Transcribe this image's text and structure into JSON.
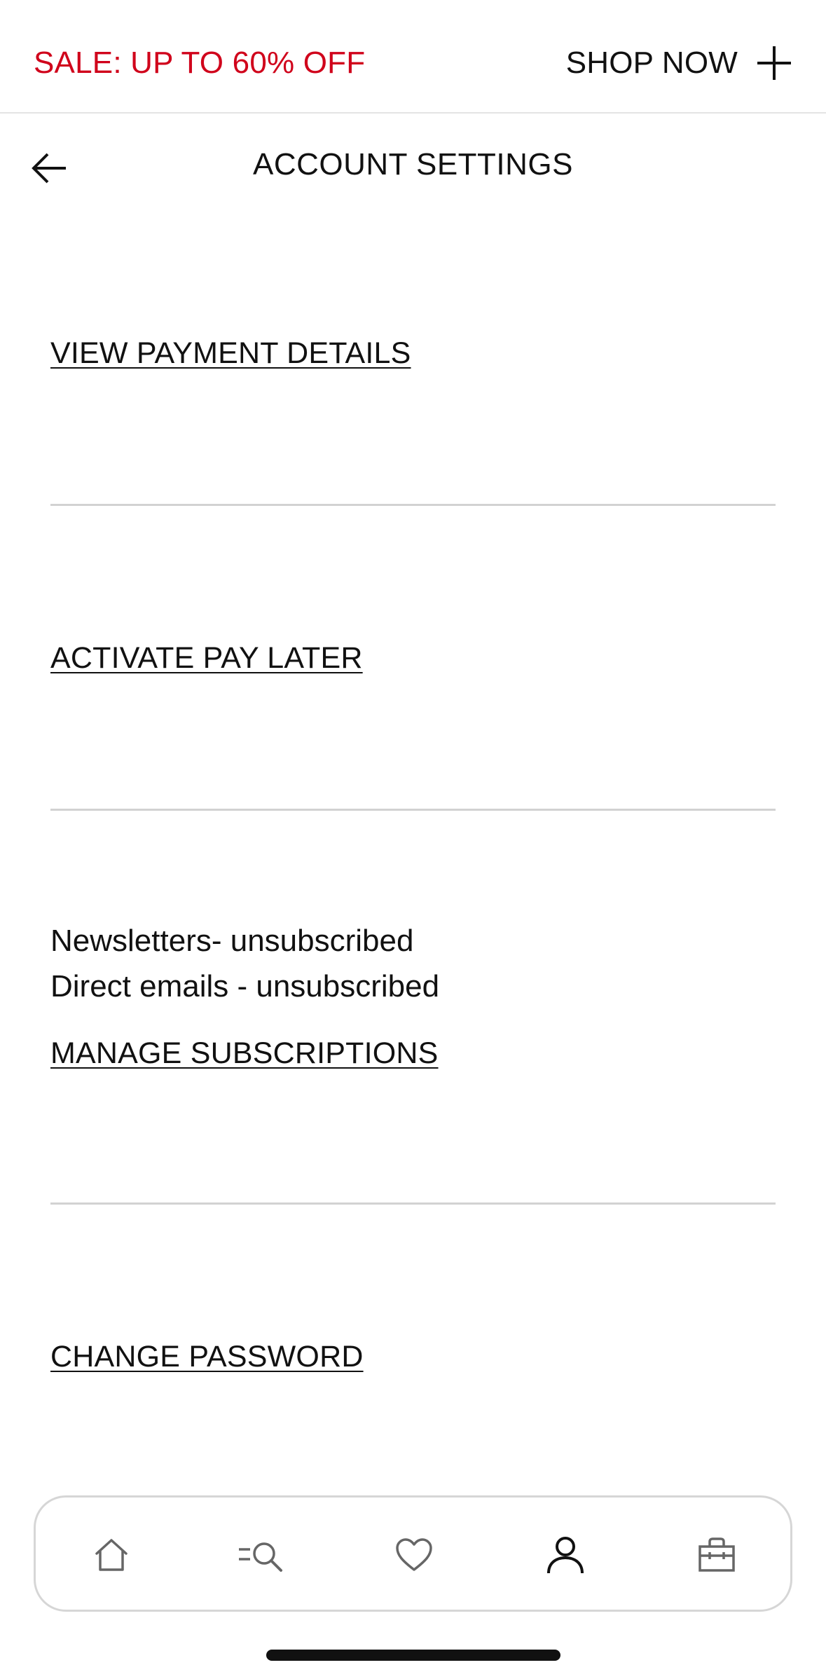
{
  "promo": {
    "text": "SALE: UP TO 60% OFF",
    "cta_label": "SHOP NOW",
    "accent_color": "#d0021b"
  },
  "header": {
    "title": "ACCOUNT SETTINGS",
    "back_icon": "arrow-left-icon"
  },
  "sections": {
    "payment_details": {
      "link_label": "VIEW PAYMENT DETAILS"
    },
    "pay_later": {
      "link_label": "ACTIVATE PAY LATER"
    },
    "subscriptions": {
      "newsletters_status": "Newsletters- unsubscribed",
      "direct_emails_status": "Direct emails - unsubscribed",
      "link_label": "MANAGE SUBSCRIPTIONS"
    },
    "password": {
      "link_label": "CHANGE PASSWORD"
    }
  },
  "bottom_nav": {
    "items": [
      {
        "icon": "home-icon",
        "active": false
      },
      {
        "icon": "search-categories-icon",
        "active": false
      },
      {
        "icon": "heart-icon",
        "active": false
      },
      {
        "icon": "account-icon",
        "active": true
      },
      {
        "icon": "shopping-bag-icon",
        "active": false
      }
    ]
  }
}
